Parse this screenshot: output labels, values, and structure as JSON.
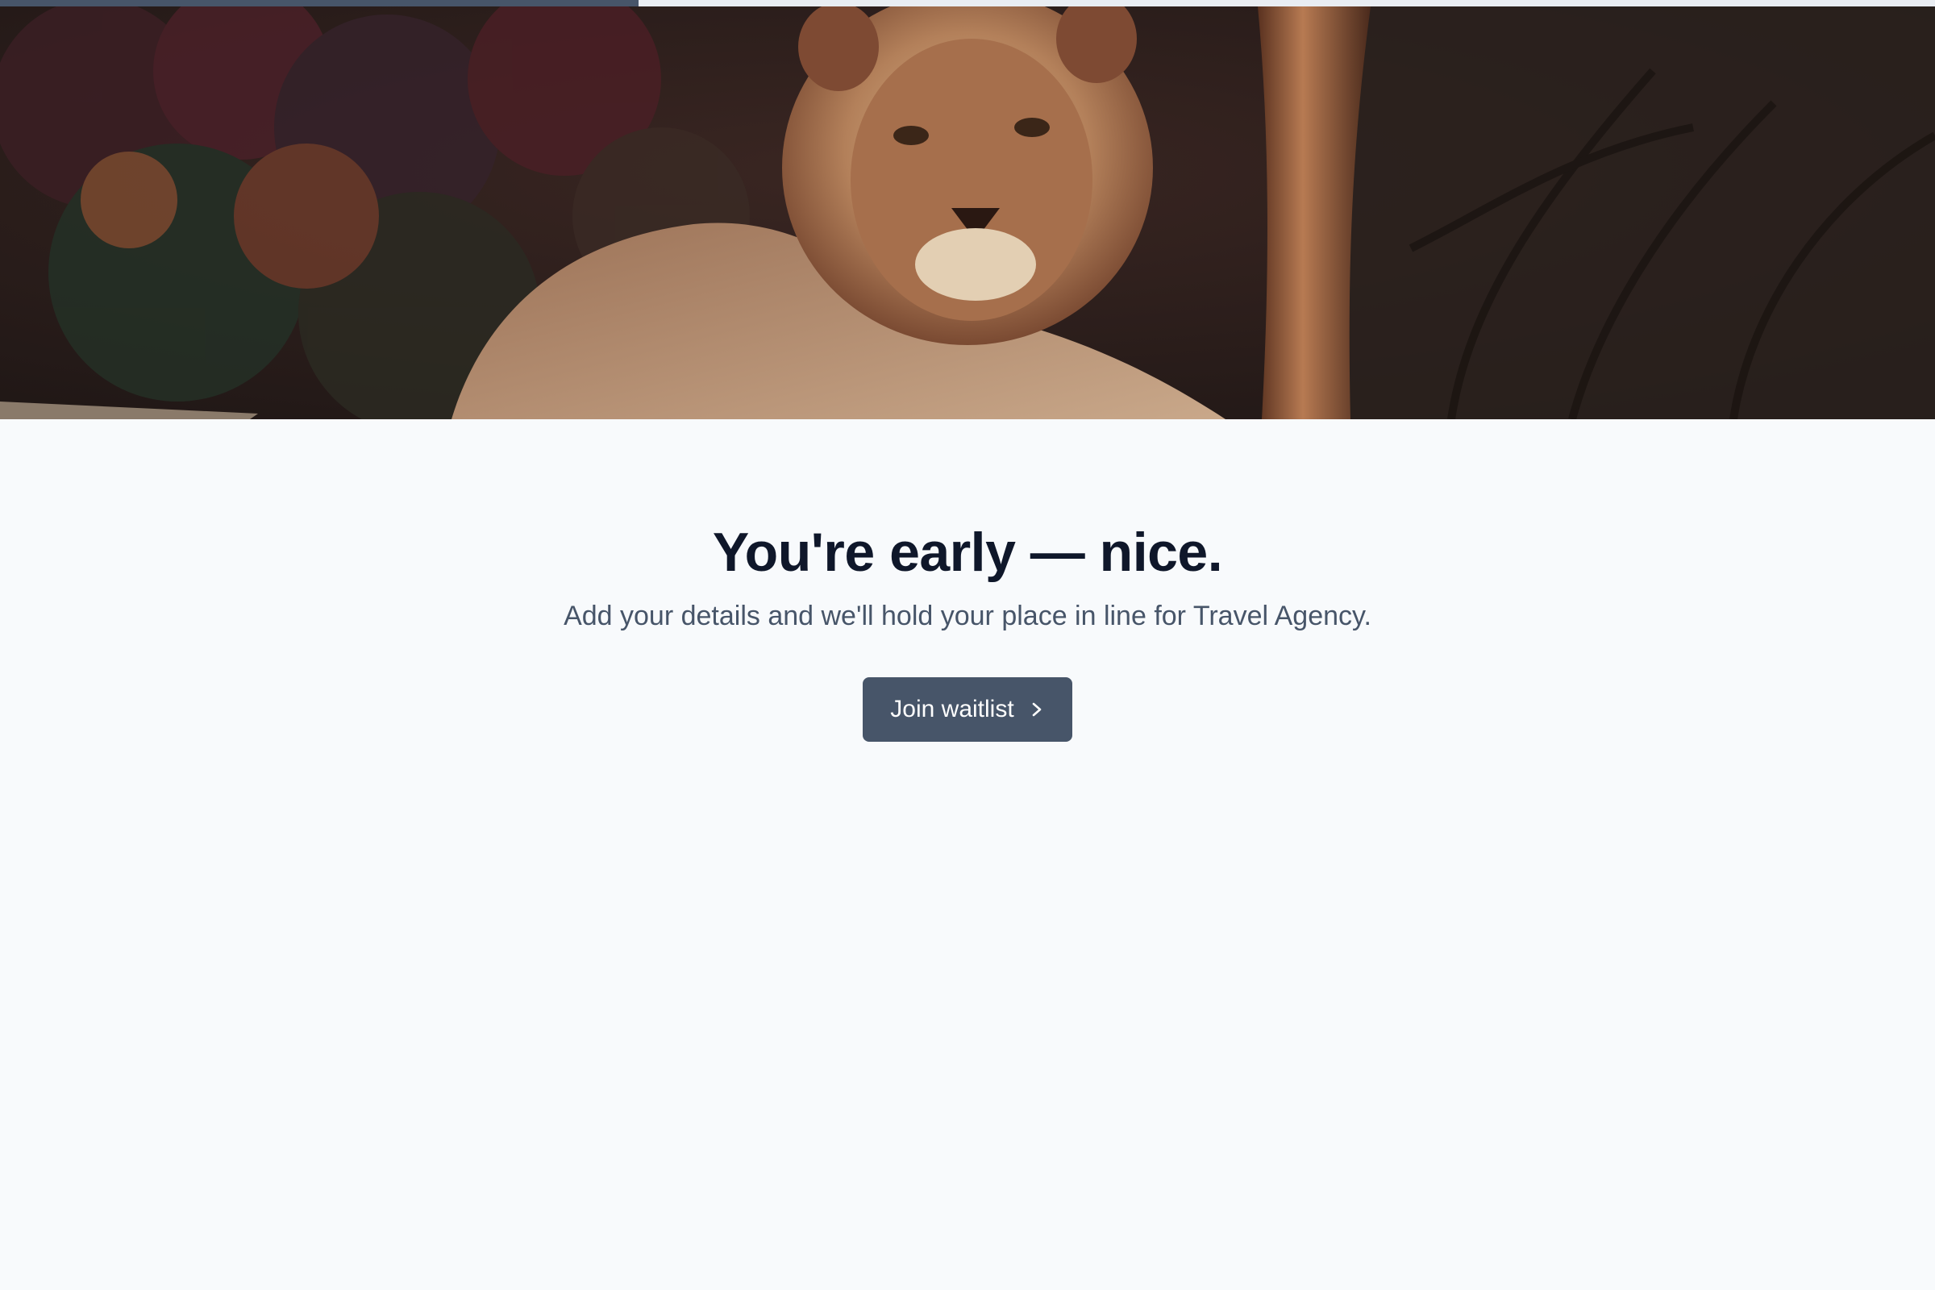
{
  "progress": {
    "fraction": 0.33
  },
  "hero": {
    "image": "lion-photo"
  },
  "main": {
    "headline": "You're early — nice.",
    "subline": "Add your details and we'll hold your place in line for Travel Agency.",
    "cta_label": "Join waitlist",
    "cta_icon": "chevron-right-icon"
  },
  "colors": {
    "background": "#f8fafc",
    "accent": "#475569",
    "headline": "#0f172a",
    "subline": "#475569"
  }
}
